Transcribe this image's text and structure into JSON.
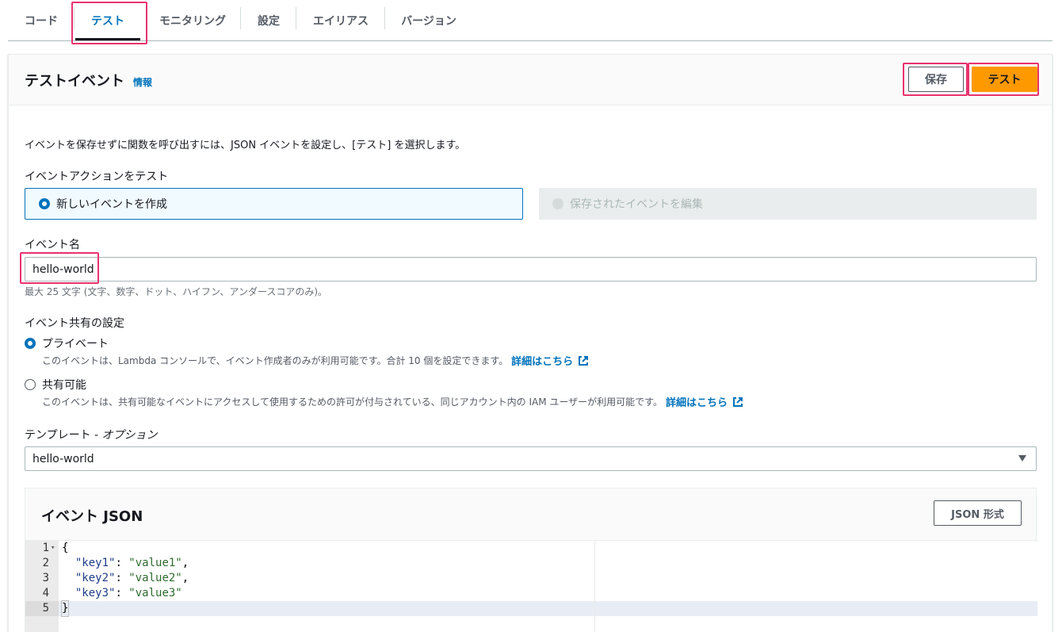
{
  "tabs": [
    {
      "label": "コード"
    },
    {
      "label": "テスト"
    },
    {
      "label": "モニタリング"
    },
    {
      "label": "設定"
    },
    {
      "label": "エイリアス"
    },
    {
      "label": "バージョン"
    }
  ],
  "panel": {
    "title": "テストイベント",
    "info_link": "情報",
    "save_button": "保存",
    "test_button": "テスト"
  },
  "description": "イベントを保存せずに関数を呼び出すには、JSON イベントを設定し、[テスト] を選択します。",
  "event_action": {
    "label": "イベントアクションをテスト",
    "option_new": "新しいイベントを作成",
    "option_edit": "保存されたイベントを編集"
  },
  "event_name": {
    "label": "イベント名",
    "value": "hello-world",
    "hint": "最大 25 文字 (文字、数字、ドット、ハイフン、アンダースコアのみ)。"
  },
  "sharing": {
    "label": "イベント共有の設定",
    "private_label": "プライベート",
    "private_desc": "このイベントは、Lambda コンソールで、イベント作成者のみが利用可能です。合計 10 個を設定できます。",
    "shareable_label": "共有可能",
    "shareable_desc": "このイベントは、共有可能なイベントにアクセスして使用するための許可が付与されている、同じアカウント内の IAM ユーザーが利用可能です。",
    "learn_more": "詳細はこちら"
  },
  "template": {
    "label": "テンプレート - ",
    "label_optional": "オプション",
    "value": "hello-world"
  },
  "event_json": {
    "title": "イベント JSON",
    "format_button": "JSON 形式",
    "lines": [
      {
        "num": "1",
        "open": "{"
      },
      {
        "num": "2",
        "key": "\"key1\"",
        "value": "\"value1\"",
        "comma": ","
      },
      {
        "num": "3",
        "key": "\"key2\"",
        "value": "\"value2\"",
        "comma": ","
      },
      {
        "num": "4",
        "key": "\"key3\"",
        "value": "\"value3\"",
        "comma": ""
      },
      {
        "num": "5",
        "close": "}"
      }
    ]
  },
  "colors": {
    "accent": "#0073bb",
    "primary_button": "#ff9900",
    "highlight": "#e8336e"
  }
}
